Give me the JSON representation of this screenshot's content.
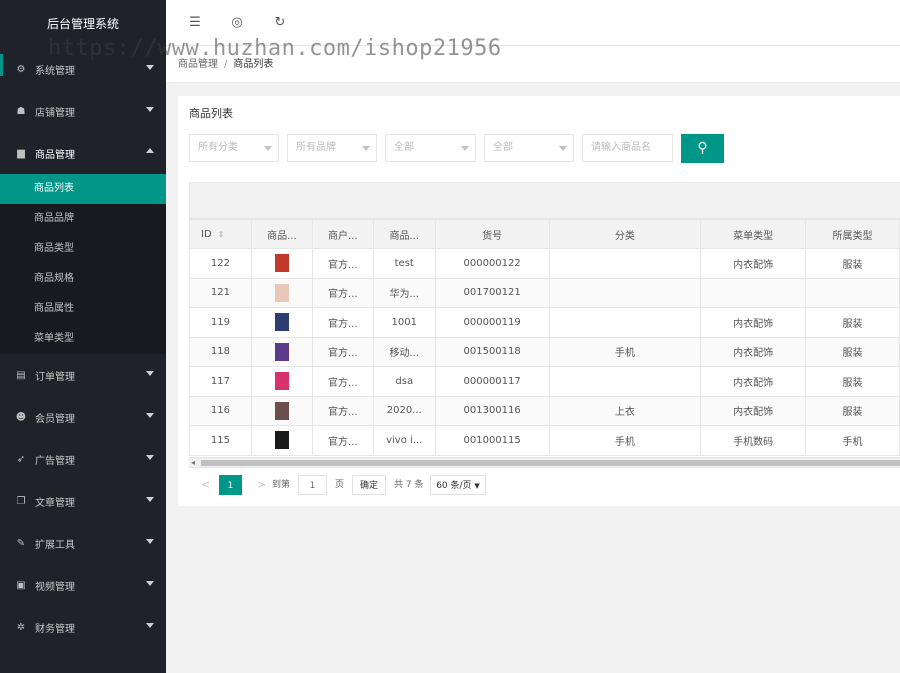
{
  "watermark": "https://www.huzhan.com/ishop21956",
  "sidebar": {
    "logo": "后台管理系统",
    "menus": [
      {
        "label": "系统管理",
        "icon": "gear-icon",
        "glyph": "⚙",
        "open": false
      },
      {
        "label": "店铺管理",
        "icon": "store-icon",
        "glyph": "☗",
        "open": false
      },
      {
        "label": "商品管理",
        "icon": "bar-chart-icon",
        "glyph": "▆",
        "open": true
      },
      {
        "label": "订单管理",
        "icon": "calendar-icon",
        "glyph": "▤",
        "open": false
      },
      {
        "label": "会员管理",
        "icon": "users-icon",
        "glyph": "☻",
        "open": false
      },
      {
        "label": "广告管理",
        "icon": "rocket-icon",
        "glyph": "➶",
        "open": false
      },
      {
        "label": "文章管理",
        "icon": "copy-icon",
        "glyph": "❐",
        "open": false
      },
      {
        "label": "扩展工具",
        "icon": "wrench-icon",
        "glyph": "✎",
        "open": false
      },
      {
        "label": "视频管理",
        "icon": "camera-icon",
        "glyph": "▣",
        "open": false
      },
      {
        "label": "财务管理",
        "icon": "settings-icon",
        "glyph": "✲",
        "open": false
      }
    ],
    "submenu": [
      "商品列表",
      "商品品牌",
      "商品类型",
      "商品规格",
      "商品属性",
      "菜单类型"
    ],
    "active_sub": 0
  },
  "header": {
    "icons": [
      "menu-fold-icon",
      "globe-icon",
      "refresh-icon"
    ]
  },
  "breadcrumb": {
    "parent": "商品管理",
    "separator": "/",
    "current": "商品列表"
  },
  "card": {
    "title": "商品列表"
  },
  "filters": [
    {
      "placeholder": "所有分类"
    },
    {
      "placeholder": "所有品牌"
    },
    {
      "placeholder": "全部"
    },
    {
      "placeholder": "全部"
    }
  ],
  "search": {
    "placeholder": "请输入商品名",
    "button_icon": "search-icon"
  },
  "table": {
    "columns": [
      "ID",
      "商品...",
      "商户...",
      "商品...",
      "货号",
      "分类",
      "菜单类型",
      "所属类型"
    ],
    "rows": [
      {
        "id": "122",
        "img": "#c0392b",
        "merchant": "官方...",
        "name": "test",
        "sn": "000000122",
        "cat": "",
        "menu": "内衣配饰",
        "type": "服装"
      },
      {
        "id": "121",
        "img": "#e8c8b8",
        "merchant": "官方...",
        "name": "华为...",
        "sn": "001700121",
        "cat": "",
        "menu": "",
        "type": ""
      },
      {
        "id": "119",
        "img": "#2c3e70",
        "merchant": "官方...",
        "name": "1001",
        "sn": "000000119",
        "cat": "",
        "menu": "内衣配饰",
        "type": "服装"
      },
      {
        "id": "118",
        "img": "#5b3a8a",
        "merchant": "官方...",
        "name": "移动...",
        "sn": "001500118",
        "cat": "手机",
        "menu": "内衣配饰",
        "type": "服装"
      },
      {
        "id": "117",
        "img": "#d6336c",
        "merchant": "官方...",
        "name": "dsa",
        "sn": "000000117",
        "cat": "",
        "menu": "内衣配饰",
        "type": "服装"
      },
      {
        "id": "116",
        "img": "#6b4f4f",
        "merchant": "官方...",
        "name": "2020...",
        "sn": "001300116",
        "cat": "上衣",
        "menu": "内衣配饰",
        "type": "服装"
      },
      {
        "id": "115",
        "img": "#1a1a1a",
        "merchant": "官方...",
        "name": "vivo i...",
        "sn": "001000115",
        "cat": "手机",
        "menu": "手机数码",
        "type": "手机"
      }
    ]
  },
  "pager": {
    "prev": "<",
    "page": "1",
    "next": ">",
    "goto_label": "到第",
    "goto_value": "1",
    "page_unit": "页",
    "confirm": "确定",
    "total": "共 7 条",
    "page_size": "60 条/页"
  }
}
